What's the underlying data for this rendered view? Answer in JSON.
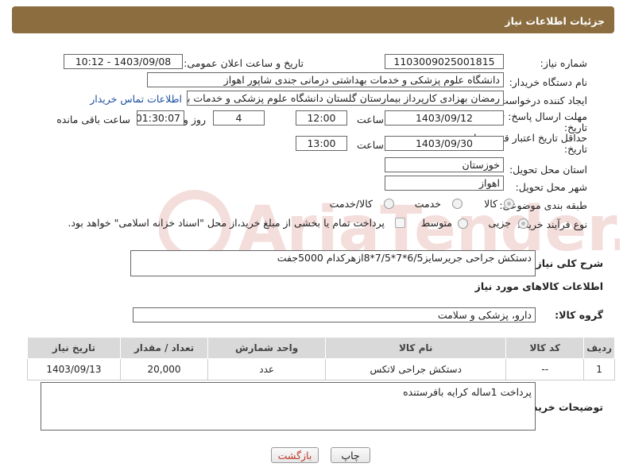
{
  "header": {
    "title": "جزئیات اطلاعات نیاز"
  },
  "fields": {
    "need_number": {
      "label": "شماره نیاز:",
      "value": "1103009025001815"
    },
    "announce_datetime": {
      "label": "تاریخ و ساعت اعلان عمومی:",
      "value": "1403/09/08 - 10:12"
    },
    "buyer_org": {
      "label": "نام دستگاه خریدار:",
      "value": "دانشگاه علوم پزشکی و خدمات بهداشتی درمانی جندی شاپور اهواز"
    },
    "requester": {
      "label": "ایجاد کننده درخواست:",
      "value": "رمضان بهزادی کارپرداز بیمارستان گلستان دانشگاه علوم پزشکی و خدمات بهداشتی",
      "contact_link": "اطلاعات تماس خریدار"
    },
    "reply_deadline": {
      "label_line1": "مهلت ارسال پاسخ: تا",
      "label_line2": "تاریخ:",
      "date": "1403/09/12",
      "time_label": "ساعت",
      "time": "12:00",
      "days": "4",
      "days_label": "روز و",
      "remaining": "01:30:07",
      "remaining_label": "ساعت باقی مانده"
    },
    "price_validity": {
      "label_line1": "حداقل تاریخ اعتبار قیمت: تا",
      "label_line2": "تاریخ:",
      "date": "1403/09/30",
      "time_label": "ساعت",
      "time": "13:00"
    },
    "province": {
      "label": "استان محل تحویل:",
      "value": "خوزستان"
    },
    "city": {
      "label": "شهر محل تحویل:",
      "value": "اهواز"
    },
    "category": {
      "label": "طبقه بندی موضوعی:",
      "options": [
        "کالا",
        "خدمت",
        "کالا/خدمت"
      ],
      "selected": "کالا"
    },
    "purchase_type": {
      "label": "نوع فرآیند خرید :",
      "options": [
        "جزیی",
        "متوسط"
      ],
      "selected": "جزیی",
      "note": "پرداخت تمام یا بخشی از مبلغ خرید،از محل \"اسناد خزانه اسلامی\" خواهد بود."
    }
  },
  "summary": {
    "label": "شرح کلی نیاز:",
    "value": "دستکش جراحی جریرسایز6/5*7*7/5*8ازهرکدام 5000جفت"
  },
  "goods_section": {
    "title": "اطلاعات کالاهای مورد نیاز",
    "group_label": "گروه کالا:",
    "group_value": "دارو، پزشکی و سلامت"
  },
  "table": {
    "headers": [
      "ردیف",
      "کد کالا",
      "نام کالا",
      "واحد شمارش",
      "تعداد / مقدار",
      "تاریخ نیاز"
    ],
    "rows": [
      [
        "1",
        "--",
        "دستکش جراحی لاتکس",
        "عدد",
        "20,000",
        "1403/09/13"
      ]
    ]
  },
  "buyer_notes": {
    "label": "توضیحات خریدار:",
    "value": "پرداخت 1ساله کرایه بافرستنده"
  },
  "buttons": {
    "print": "چاپ",
    "back": "بازگشت"
  },
  "watermark": {
    "text": "AriaTender.net"
  }
}
